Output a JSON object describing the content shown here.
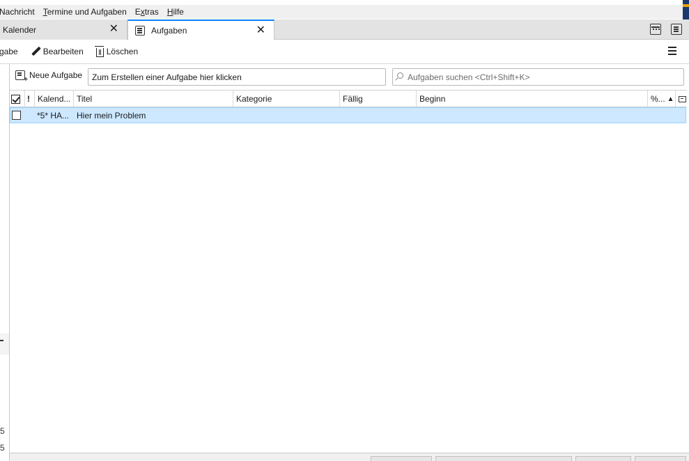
{
  "menubar": {
    "items": [
      {
        "label": "Nachricht",
        "underline": ""
      },
      {
        "label": "Termine und Aufgaben",
        "underline": "T"
      },
      {
        "label": "Extras",
        "underline": "x"
      },
      {
        "label": "Hilfe",
        "underline": "H"
      }
    ]
  },
  "tabs": [
    {
      "label": "Kalender",
      "active": false
    },
    {
      "label": "Aufgaben",
      "active": true
    }
  ],
  "tabbar_icons": [
    "calendar-icon",
    "tasks-icon"
  ],
  "toolbar": {
    "new_label": "gabe",
    "edit_label": "Bearbeiten",
    "delete_label": "Löschen"
  },
  "quickadd": {
    "new_task_label": "Neue Aufgabe",
    "input_value": "Zum Erstellen einer Aufgabe hier klicken",
    "search_placeholder": "Aufgaben suchen <Ctrl+Shift+K>"
  },
  "columns": {
    "priority": "!",
    "calendar": "Kalend...",
    "title": "Titel",
    "category": "Kategorie",
    "due": "Fällig",
    "start": "Beginn",
    "percent": "%...",
    "sort_indicator": "^"
  },
  "rows": [
    {
      "calendar": "*5* HA...",
      "title": "Hier mein Problem",
      "category": "",
      "due": "",
      "start": "",
      "completed": false
    }
  ],
  "left_glyphs": [
    "-",
    "5",
    "5"
  ],
  "colors": {
    "selection_bg": "#cde8ff",
    "selection_border": "#99d1ff",
    "active_tab_accent": "#0a84ff"
  }
}
